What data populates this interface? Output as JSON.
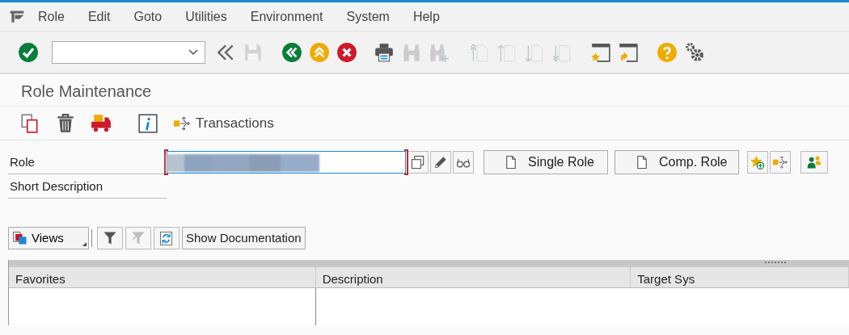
{
  "menu_bar": {
    "items": [
      {
        "label": "Role"
      },
      {
        "label": "Edit"
      },
      {
        "label": "Goto"
      },
      {
        "label": "Utilities"
      },
      {
        "label": "Environment"
      },
      {
        "label": "System"
      },
      {
        "label": "Help"
      }
    ]
  },
  "toolbar": {
    "buttons": [
      {
        "kind": "enter",
        "disabled": false
      },
      {
        "kind": "command-field"
      },
      {
        "kind": "collapse",
        "disabled": false
      },
      {
        "kind": "save",
        "disabled": true
      },
      {
        "kind": "back",
        "disabled": false
      },
      {
        "kind": "exit",
        "disabled": false
      },
      {
        "kind": "cancel",
        "disabled": false
      },
      {
        "kind": "print",
        "disabled": false
      },
      {
        "kind": "find",
        "disabled": true
      },
      {
        "kind": "find-next",
        "disabled": true
      },
      {
        "kind": "first-page",
        "disabled": true
      },
      {
        "kind": "previous-page",
        "disabled": true
      },
      {
        "kind": "next-page",
        "disabled": true
      },
      {
        "kind": "last-page",
        "disabled": true
      },
      {
        "kind": "new-session",
        "disabled": false
      },
      {
        "kind": "shortcut",
        "disabled": false
      },
      {
        "kind": "help",
        "disabled": false
      },
      {
        "kind": "settings",
        "disabled": false
      }
    ]
  },
  "title": "Role Maintenance",
  "app_toolbar": [
    {
      "kind": "copy"
    },
    {
      "kind": "delete"
    },
    {
      "kind": "transport"
    },
    {
      "kind": "info"
    },
    {
      "kind": "transactions",
      "label": "Transactions"
    }
  ],
  "form": {
    "fields": [
      {
        "label": "Role",
        "focused": true,
        "required": true,
        "value_blurred": true
      },
      {
        "label": "Short Description"
      }
    ],
    "field_buttons": [
      {
        "kind": "possible-entries"
      },
      {
        "kind": "change"
      },
      {
        "kind": "display"
      }
    ],
    "buttons": [
      {
        "kind": "document",
        "label": "Single Role"
      },
      {
        "kind": "document",
        "label": "Comp. Role"
      }
    ],
    "icon_buttons": [
      {
        "kind": "add-favorite"
      },
      {
        "kind": "transactions"
      },
      {
        "kind": "users"
      }
    ]
  },
  "tree_toolbar": {
    "views": {
      "label": "Views"
    },
    "buttons": [
      {
        "kind": "filter",
        "disabled": false
      },
      {
        "kind": "filter-off",
        "disabled": true
      },
      {
        "kind": "refresh",
        "disabled": false
      }
    ],
    "documentation": {
      "label": "Show Documentation"
    }
  },
  "table": {
    "columns": [
      {
        "label": "Favorites"
      },
      {
        "label": "Description"
      },
      {
        "label": "Target Sys"
      }
    ]
  }
}
